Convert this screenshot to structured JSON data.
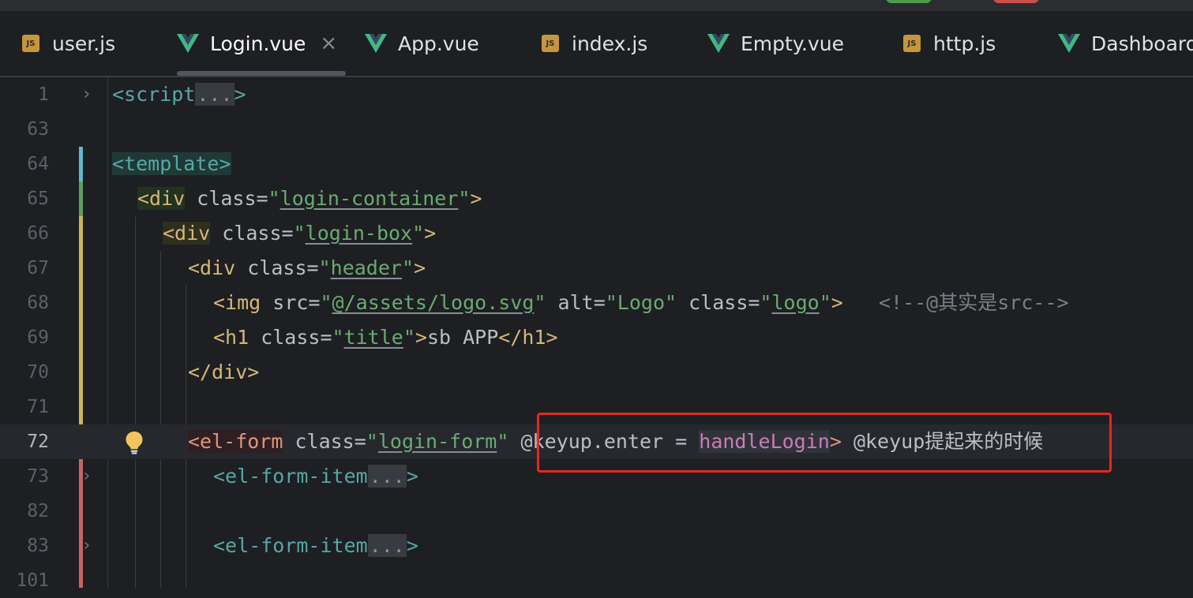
{
  "tabs": [
    {
      "label": "user.js",
      "icon": "js-icon",
      "active": false
    },
    {
      "label": "Login.vue",
      "icon": "vue-icon",
      "active": true
    },
    {
      "label": "App.vue",
      "icon": "vue-icon",
      "active": false
    },
    {
      "label": "index.js",
      "icon": "js-icon",
      "active": false
    },
    {
      "label": "Empty.vue",
      "icon": "vue-icon",
      "active": false
    },
    {
      "label": "http.js",
      "icon": "js-icon",
      "active": false
    },
    {
      "label": "Dashboard.vue",
      "icon": "vue-icon",
      "active": false
    }
  ],
  "js_icon_text": "JS",
  "close_glyph": "×",
  "fold_closed": "›",
  "line_numbers": [
    "1",
    "63",
    "64",
    "65",
    "66",
    "67",
    "68",
    "69",
    "70",
    "71",
    "72",
    "73",
    "82",
    "83",
    "101"
  ],
  "current_line": "72",
  "code": {
    "l1": {
      "open": "<script",
      "fold": "...",
      "close": ">"
    },
    "l64": {
      "tag": "<template>"
    },
    "l65": {
      "open": "<div",
      "attr": " class=",
      "q1": "\"",
      "val": "login-container",
      "q2": "\"",
      "close": ">"
    },
    "l66": {
      "open": "<div",
      "attr": " class=",
      "q1": "\"",
      "val": "login-box",
      "q2": "\"",
      "close": ">"
    },
    "l67": {
      "open": "<div",
      "attr": " class=",
      "q1": "\"",
      "val": "header",
      "q2": "\"",
      "close": ">"
    },
    "l68": {
      "open": "<img",
      "a1": " src=",
      "q1": "\"",
      "v1": "@/assets/logo.svg",
      "q2": "\"",
      "a2": " alt=",
      "v2": "\"Logo\"",
      "a3": " class=",
      "q3": "\"",
      "v3": "logo",
      "q4": "\"",
      "close": ">",
      "comment": "   <!--@其实是src-->"
    },
    "l69": {
      "open": "<h1",
      "attr": " class=",
      "q1": "\"",
      "val": "title",
      "q2": "\"",
      "close": ">",
      "text": "sb APP",
      "end": "</h1>"
    },
    "l70": {
      "tag": "</div>"
    },
    "l72": {
      "open": "<el-form",
      "attr": " class=",
      "q1": "\"",
      "val": "login-form",
      "q2": "\"",
      "sp": " ",
      "event": "@keyup.enter",
      "eq": " = ",
      "handler": "handleLogin",
      "close": ">",
      "note": " @keyup提起来的时候"
    },
    "l73": {
      "open": "<el-form-item",
      "fold": "...",
      "close": ">"
    },
    "l83": {
      "open": "<el-form-item",
      "fold": "...",
      "close": ">"
    }
  },
  "colors": {
    "background": "#1e1f22",
    "tag": "#56a8a6",
    "string": "#6aab73",
    "function": "#c77dbb",
    "annotation_box": "#e8271f"
  }
}
